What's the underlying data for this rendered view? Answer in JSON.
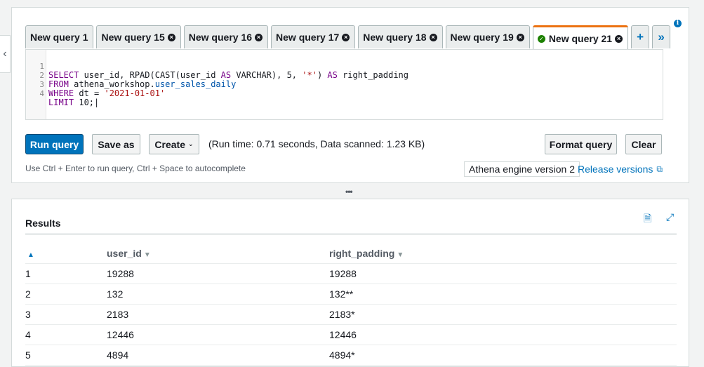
{
  "colors": {
    "accent": "#0073bb",
    "active_tab_top": "#ec7211",
    "success": "#1d8102"
  },
  "tabs": [
    {
      "label": "New query 1",
      "closable": false,
      "active": false
    },
    {
      "label": "New query 15",
      "closable": true,
      "active": false
    },
    {
      "label": "New query 16",
      "closable": true,
      "active": false
    },
    {
      "label": "New query 17",
      "closable": true,
      "active": false
    },
    {
      "label": "New query 18",
      "closable": true,
      "active": false
    },
    {
      "label": "New query 19",
      "closable": true,
      "active": false
    },
    {
      "label": "New query 21",
      "closable": true,
      "active": true,
      "status_icon": "check-circle-icon"
    }
  ],
  "tab_actions": {
    "add_icon": "+",
    "more_icon": "»"
  },
  "editor": {
    "line_numbers": [
      "1",
      "2",
      "3",
      "4"
    ],
    "lines": [
      "SELECT user_id, RPAD(CAST(user_id AS VARCHAR), 5, '*') AS right_padding",
      "FROM athena_workshop.user_sales_daily",
      "WHERE dt = '2021-01-01'",
      "LIMIT 10;"
    ]
  },
  "toolbar": {
    "run_label": "Run query",
    "save_as_label": "Save as",
    "create_label": "Create",
    "run_info": "(Run time: 0.71 seconds, Data scanned: 1.23 KB)",
    "format_label": "Format query",
    "clear_label": "Clear"
  },
  "footer": {
    "hint": "Use Ctrl + Enter to run query, Ctrl + Space to autocomplete",
    "engine": "Athena engine version 2",
    "release_link": "Release versions"
  },
  "results": {
    "title": "Results",
    "columns": [
      "",
      "user_id",
      "right_padding"
    ],
    "rows": [
      [
        "1",
        "19288",
        "19288"
      ],
      [
        "2",
        "132",
        "132**"
      ],
      [
        "3",
        "2183",
        "2183*"
      ],
      [
        "4",
        "12446",
        "12446"
      ],
      [
        "5",
        "4894",
        "4894*"
      ]
    ]
  }
}
